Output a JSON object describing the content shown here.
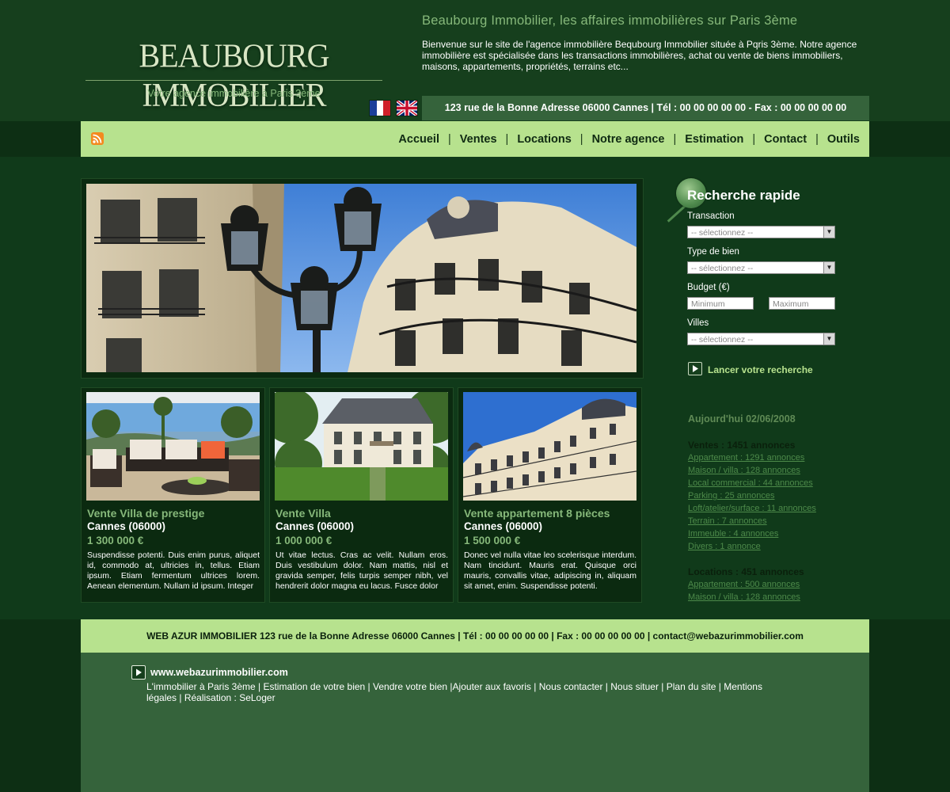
{
  "header": {
    "logo_title": "BEAUBOURG IMMOBILIER",
    "logo_tagline": "Votre agence immobilière à Paris 3ème",
    "site_title": "Beaubourg Immobilier, les affaires immobilières sur Paris 3ème",
    "intro": "Bienvenue sur le site de l'agence immobilière Bequbourg Immobilier située à Pqris 3ème. Notre agence immobilière est spécialisée dans les transactions immobilières, achat ou vente de biens immobiliers, maisons, appartements, propriétés, terrains etc...",
    "address_bar": "123 rue de la Bonne Adresse 06000 Cannes   |   Tél : 00 00 00 00 00   -   Fax : 00 00 00 00 00"
  },
  "nav": {
    "items": [
      "Accueil",
      "Ventes",
      "Locations",
      "Notre agence",
      "Estimation",
      "Contact",
      "Outils"
    ],
    "separator": "|"
  },
  "listings": [
    {
      "title": "Vente Villa de prestige",
      "location": "Cannes (06000)",
      "price": "1 300 000 €",
      "description": "Suspendisse potenti. Duis enim purus, aliquet id, commodo at, ultricies in, tellus. Etiam ipsum. Etiam fermentum ultrices lorem. Aenean elementum. Nullam id ipsum. Integer"
    },
    {
      "title": "Vente Villa",
      "location": "Cannes (06000)",
      "price": "1 000 000 €",
      "description": "Ut vitae lectus. Cras ac velit. Nullam eros. Duis vestibulum dolor. Nam mattis, nisl et gravida semper, felis turpis semper nibh, vel hendrerit dolor magna eu lacus. Fusce dolor"
    },
    {
      "title": "Vente appartement 8 pièces",
      "location": "Cannes (06000)",
      "price": "1 500 000 €",
      "description": "Donec vel nulla vitae leo scelerisque interdum. Nam tincidunt. Mauris erat. Quisque orci mauris, convallis vitae, adipiscing in, aliquam sit amet, enim. Suspendisse potenti."
    }
  ],
  "search": {
    "title": "Recherche rapide",
    "transaction_label": "Transaction",
    "transaction_value": "-- sélectionnez --",
    "type_label": "Type de bien",
    "type_value": "-- sélectionnez --",
    "budget_label": "Budget (€)",
    "budget_min_placeholder": "Minimum",
    "budget_max_placeholder": "Maximum",
    "villes_label": "Villes",
    "villes_value": "-- sélectionnez --",
    "launch_label": "Lancer votre recherche"
  },
  "stats": {
    "today": "Aujourd'hui 02/06/2008",
    "ventes_title": "Ventes : 1451 annonces",
    "ventes": [
      "Appartement : 1291 annonces",
      "Maison / villa : 128 annonces",
      "Local commercial : 44 annonces",
      "Parking : 25 annonces",
      "Loft/atelier/surface : 11 annonces",
      "Terrain : 7 annonces",
      "Immeuble : 4 annonces",
      "Divers : 1 annonce"
    ],
    "locations_title": "Locations : 451 annonces",
    "locations": [
      "Appartement : 500 annonces",
      "Maison / villa : 128 annonces"
    ]
  },
  "footer": {
    "bar": "WEB AZUR IMMOBILIER   123 rue de la Bonne Adresse 06000 Cannes   |   Tél : 00 00 00 00 00   |   Fax : 00 00 00 00 00   |   contact@webazurimmobilier.com",
    "site": "www.webazurimmobilier.com",
    "links": [
      "L'immobilier à Paris 3ème",
      "Estimation de votre bien",
      "Vendre votre bien",
      "Ajouter aux favoris",
      "Nous contacter",
      "Nous situer",
      "Plan du site",
      "Mentions légales",
      "Réalisation : SeLoger"
    ]
  },
  "colors": {
    "page_bg": "#103a1a",
    "header_bg": "#163f1d",
    "nav_bg": "#b7e28e",
    "accent_green": "#86b87a",
    "address_bar_bg": "#35633b"
  },
  "icons": {
    "rss": "rss-icon",
    "flag_fr": "flag-fr-icon",
    "flag_uk": "flag-uk-icon",
    "search": "magnifier-icon",
    "launch": "play-arrow-icon"
  }
}
